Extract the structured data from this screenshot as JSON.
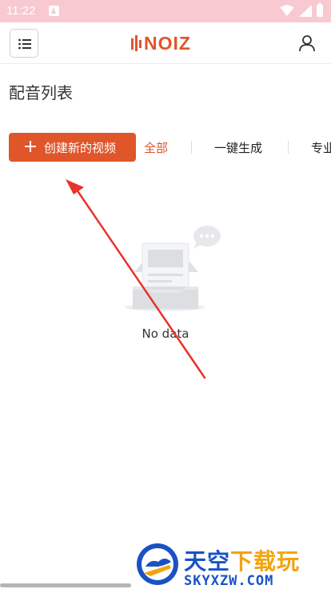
{
  "status_bar": {
    "time": "11:22",
    "color": "#f8c9d1"
  },
  "header": {
    "brand": "NOIZ",
    "brand_color": "#e0552a",
    "menu_icon": "list-icon",
    "user_icon": "user-icon"
  },
  "page": {
    "title": "配音列表"
  },
  "toolbar": {
    "create_label": "创建新的视频",
    "create_icon": "plus-icon",
    "tabs": [
      {
        "label": "全部",
        "active": true
      },
      {
        "label": "一键生成",
        "active": false
      },
      {
        "label": "专业",
        "active": false
      }
    ]
  },
  "empty_state": {
    "text": "No data",
    "icon": "empty-inbox-icon"
  },
  "annotation": {
    "type": "red-arrow",
    "color": "#e8322a"
  },
  "watermark": {
    "title_part1": "天空",
    "title_part2": "下载玩",
    "url": "SKYXZW.COM"
  }
}
